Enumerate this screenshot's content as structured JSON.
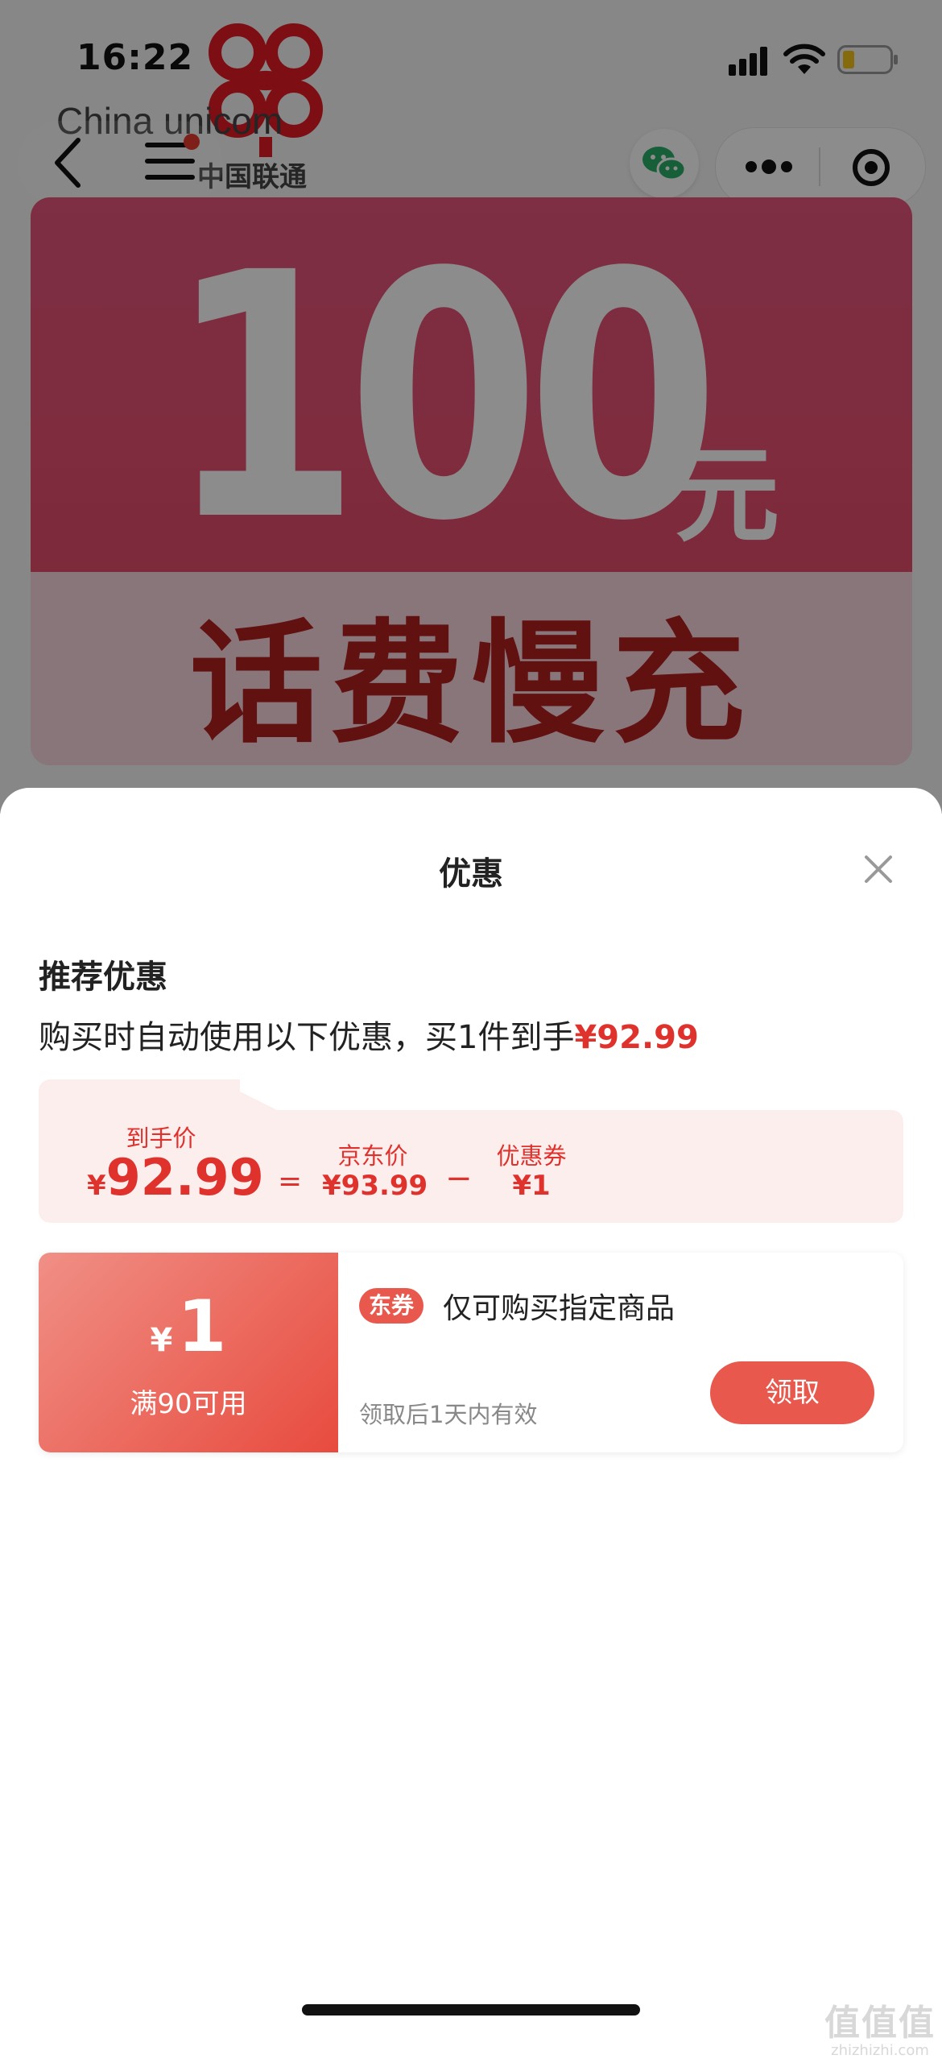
{
  "status_bar": {
    "time": "16:22"
  },
  "brand": {
    "english": "China unicom",
    "chinese": "中国联通"
  },
  "banner": {
    "amount": "100",
    "unit": "元",
    "subtitle": "话费慢充"
  },
  "sheet": {
    "title": "优惠",
    "recommend_title": "推荐优惠",
    "recommend_desc": "购买时自动使用以下优惠，买1件到手",
    "recommend_amount": "¥92.99",
    "calc": {
      "final_label": "到手价",
      "final_currency": "¥",
      "final_value": "92.99",
      "equals": "=",
      "jd_label": "京东价",
      "jd_value": "¥93.99",
      "minus": "−",
      "coupon_label": "优惠券",
      "coupon_value": "¥1"
    },
    "coupon": {
      "currency": "¥",
      "amount": "1",
      "condition": "满90可用",
      "tag": "东券",
      "name": "仅可购买指定商品",
      "validity": "领取后1天内有效",
      "claim_label": "领取"
    }
  },
  "watermark": {
    "line1": "值值值",
    "line2": "zhizhizhi.com"
  },
  "colors": {
    "accent": "#e0322d",
    "button": "#e8584d",
    "banner_red": "#e6567c"
  }
}
